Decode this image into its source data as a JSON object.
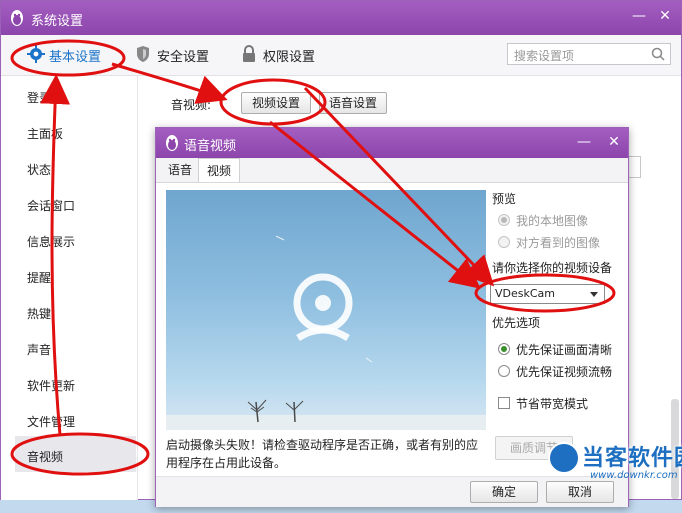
{
  "window": {
    "title": "系统设置",
    "minimize": "—",
    "close": "✕"
  },
  "toolbar": {
    "tabs": [
      {
        "label": "基本设置",
        "icon": "gear-icon",
        "color": "#1a73c9"
      },
      {
        "label": "安全设置",
        "icon": "shield-icon"
      },
      {
        "label": "权限设置",
        "icon": "lock-icon"
      }
    ],
    "search_placeholder": "搜索设置项"
  },
  "sidebar": {
    "items": [
      {
        "label": "登录"
      },
      {
        "label": "主面板"
      },
      {
        "label": "状态"
      },
      {
        "label": "会话窗口"
      },
      {
        "label": "信息展示"
      },
      {
        "label": "提醒"
      },
      {
        "label": "热键"
      },
      {
        "label": "声音"
      },
      {
        "label": "软件更新"
      },
      {
        "label": "文件管理"
      },
      {
        "label": "音视频"
      }
    ],
    "selected": "音视频"
  },
  "content": {
    "av_label": "音视频:",
    "video_settings_button": "视频设置",
    "audio_settings_button": "语音设置"
  },
  "dialog": {
    "title": "语音视频",
    "minimize": "—",
    "close": "✕",
    "tabs": [
      {
        "label": "语音"
      },
      {
        "label": "视频",
        "active": true
      }
    ],
    "preview_heading": "预览",
    "preview_options": [
      {
        "label": "我的本地图像",
        "selected": true,
        "disabled": true
      },
      {
        "label": "对方看到的图像",
        "selected": false,
        "disabled": true
      }
    ],
    "device_label": "请你选择你的视频设备",
    "device_value": "VDeskCam",
    "priority_heading": "优先选项",
    "priority_options": [
      {
        "label": "优先保证画面清晰",
        "selected": true
      },
      {
        "label": "优先保证视频流畅",
        "selected": false
      }
    ],
    "bandwidth_label": "节省带宽模式",
    "bandwidth_checked": false,
    "quality_button": "画质调节",
    "error_text": "启动摄像头失败！请检查驱动程序是否正确，或者有别的应用程序在占用此设备。",
    "ok_button": "确定",
    "cancel_button": "取消"
  },
  "watermark": {
    "name": "当客软件园",
    "url": "www.downkr.com"
  },
  "colors": {
    "title_bar": "#9a52b9",
    "annotation_red": "#e01010",
    "watermark_blue": "#1e6fc1"
  }
}
